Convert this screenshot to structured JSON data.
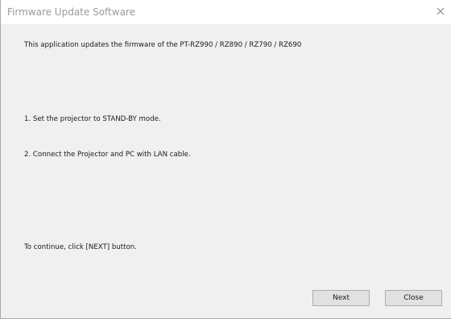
{
  "window": {
    "title": "Firmware Update Software",
    "close_glyph": "×"
  },
  "content": {
    "intro": "This application updates the firmware of the PT-RZ990 / RZ890 / RZ790 / RZ690",
    "step1": "1. Set the projector to STAND-BY mode.",
    "step2": "2. Connect the Projector and PC with LAN cable.",
    "continue": "To continue, click [NEXT] button."
  },
  "buttons": {
    "next_label": "Next",
    "close_label": "Close"
  }
}
